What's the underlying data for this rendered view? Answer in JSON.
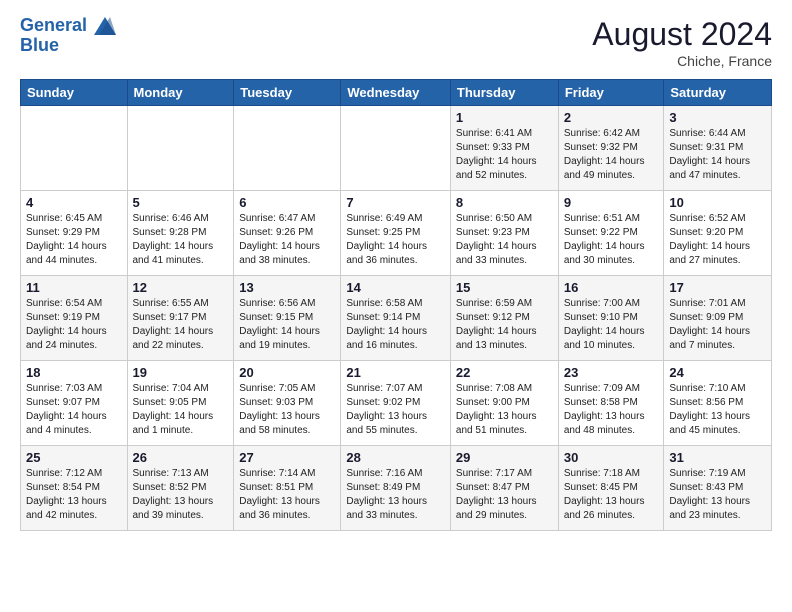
{
  "header": {
    "logo_line1": "General",
    "logo_line2": "Blue",
    "month": "August 2024",
    "location": "Chiche, France"
  },
  "weekdays": [
    "Sunday",
    "Monday",
    "Tuesday",
    "Wednesday",
    "Thursday",
    "Friday",
    "Saturday"
  ],
  "weeks": [
    [
      {
        "day": "",
        "info": ""
      },
      {
        "day": "",
        "info": ""
      },
      {
        "day": "",
        "info": ""
      },
      {
        "day": "",
        "info": ""
      },
      {
        "day": "1",
        "info": "Sunrise: 6:41 AM\nSunset: 9:33 PM\nDaylight: 14 hours\nand 52 minutes."
      },
      {
        "day": "2",
        "info": "Sunrise: 6:42 AM\nSunset: 9:32 PM\nDaylight: 14 hours\nand 49 minutes."
      },
      {
        "day": "3",
        "info": "Sunrise: 6:44 AM\nSunset: 9:31 PM\nDaylight: 14 hours\nand 47 minutes."
      }
    ],
    [
      {
        "day": "4",
        "info": "Sunrise: 6:45 AM\nSunset: 9:29 PM\nDaylight: 14 hours\nand 44 minutes."
      },
      {
        "day": "5",
        "info": "Sunrise: 6:46 AM\nSunset: 9:28 PM\nDaylight: 14 hours\nand 41 minutes."
      },
      {
        "day": "6",
        "info": "Sunrise: 6:47 AM\nSunset: 9:26 PM\nDaylight: 14 hours\nand 38 minutes."
      },
      {
        "day": "7",
        "info": "Sunrise: 6:49 AM\nSunset: 9:25 PM\nDaylight: 14 hours\nand 36 minutes."
      },
      {
        "day": "8",
        "info": "Sunrise: 6:50 AM\nSunset: 9:23 PM\nDaylight: 14 hours\nand 33 minutes."
      },
      {
        "day": "9",
        "info": "Sunrise: 6:51 AM\nSunset: 9:22 PM\nDaylight: 14 hours\nand 30 minutes."
      },
      {
        "day": "10",
        "info": "Sunrise: 6:52 AM\nSunset: 9:20 PM\nDaylight: 14 hours\nand 27 minutes."
      }
    ],
    [
      {
        "day": "11",
        "info": "Sunrise: 6:54 AM\nSunset: 9:19 PM\nDaylight: 14 hours\nand 24 minutes."
      },
      {
        "day": "12",
        "info": "Sunrise: 6:55 AM\nSunset: 9:17 PM\nDaylight: 14 hours\nand 22 minutes."
      },
      {
        "day": "13",
        "info": "Sunrise: 6:56 AM\nSunset: 9:15 PM\nDaylight: 14 hours\nand 19 minutes."
      },
      {
        "day": "14",
        "info": "Sunrise: 6:58 AM\nSunset: 9:14 PM\nDaylight: 14 hours\nand 16 minutes."
      },
      {
        "day": "15",
        "info": "Sunrise: 6:59 AM\nSunset: 9:12 PM\nDaylight: 14 hours\nand 13 minutes."
      },
      {
        "day": "16",
        "info": "Sunrise: 7:00 AM\nSunset: 9:10 PM\nDaylight: 14 hours\nand 10 minutes."
      },
      {
        "day": "17",
        "info": "Sunrise: 7:01 AM\nSunset: 9:09 PM\nDaylight: 14 hours\nand 7 minutes."
      }
    ],
    [
      {
        "day": "18",
        "info": "Sunrise: 7:03 AM\nSunset: 9:07 PM\nDaylight: 14 hours\nand 4 minutes."
      },
      {
        "day": "19",
        "info": "Sunrise: 7:04 AM\nSunset: 9:05 PM\nDaylight: 14 hours\nand 1 minute."
      },
      {
        "day": "20",
        "info": "Sunrise: 7:05 AM\nSunset: 9:03 PM\nDaylight: 13 hours\nand 58 minutes."
      },
      {
        "day": "21",
        "info": "Sunrise: 7:07 AM\nSunset: 9:02 PM\nDaylight: 13 hours\nand 55 minutes."
      },
      {
        "day": "22",
        "info": "Sunrise: 7:08 AM\nSunset: 9:00 PM\nDaylight: 13 hours\nand 51 minutes."
      },
      {
        "day": "23",
        "info": "Sunrise: 7:09 AM\nSunset: 8:58 PM\nDaylight: 13 hours\nand 48 minutes."
      },
      {
        "day": "24",
        "info": "Sunrise: 7:10 AM\nSunset: 8:56 PM\nDaylight: 13 hours\nand 45 minutes."
      }
    ],
    [
      {
        "day": "25",
        "info": "Sunrise: 7:12 AM\nSunset: 8:54 PM\nDaylight: 13 hours\nand 42 minutes."
      },
      {
        "day": "26",
        "info": "Sunrise: 7:13 AM\nSunset: 8:52 PM\nDaylight: 13 hours\nand 39 minutes."
      },
      {
        "day": "27",
        "info": "Sunrise: 7:14 AM\nSunset: 8:51 PM\nDaylight: 13 hours\nand 36 minutes."
      },
      {
        "day": "28",
        "info": "Sunrise: 7:16 AM\nSunset: 8:49 PM\nDaylight: 13 hours\nand 33 minutes."
      },
      {
        "day": "29",
        "info": "Sunrise: 7:17 AM\nSunset: 8:47 PM\nDaylight: 13 hours\nand 29 minutes."
      },
      {
        "day": "30",
        "info": "Sunrise: 7:18 AM\nSunset: 8:45 PM\nDaylight: 13 hours\nand 26 minutes."
      },
      {
        "day": "31",
        "info": "Sunrise: 7:19 AM\nSunset: 8:43 PM\nDaylight: 13 hours\nand 23 minutes."
      }
    ]
  ]
}
